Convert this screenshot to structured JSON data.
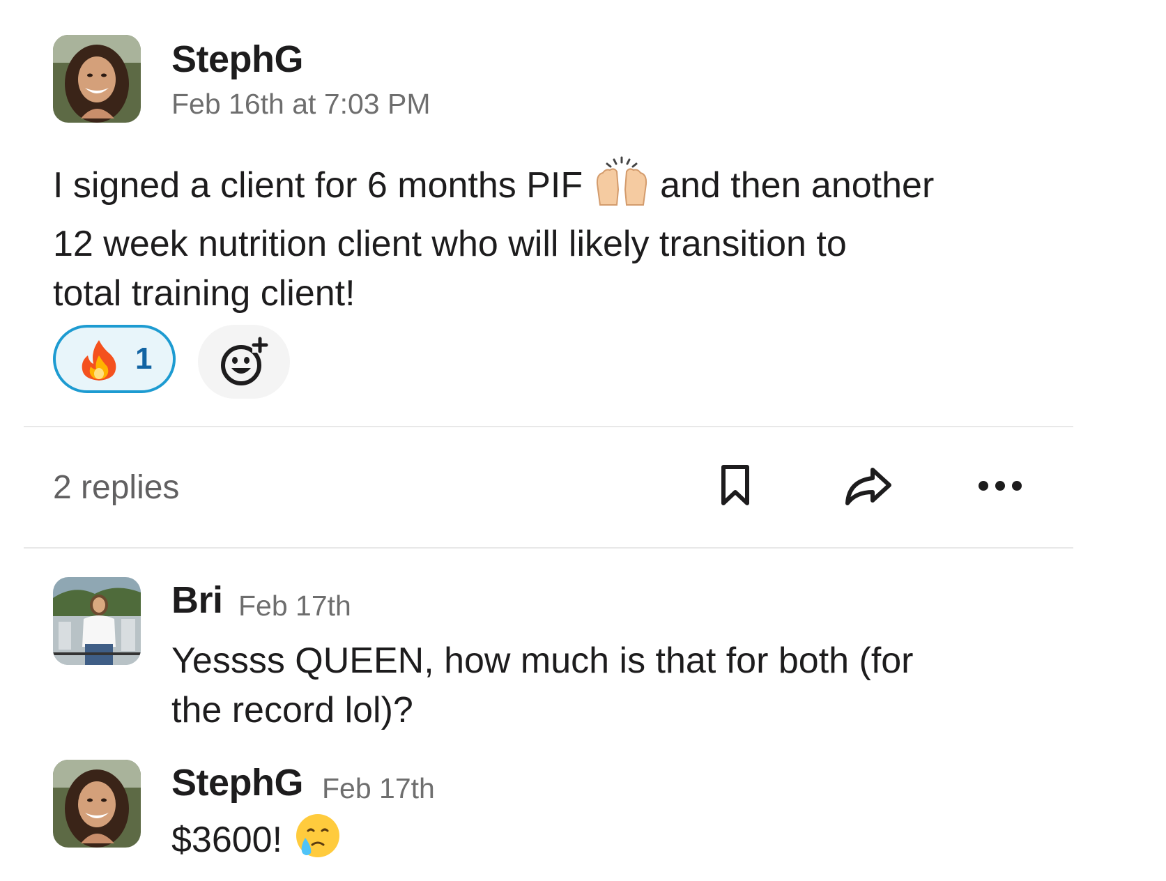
{
  "post": {
    "author": "StephG",
    "timestamp": "Feb 16th at 7:03 PM",
    "message_lines": [
      "I signed a client for 6 months PIF",
      "and then another",
      "12 week nutrition client who will likely transition to",
      "total training client!"
    ],
    "inline_emoji": "raising-hands",
    "reactions": [
      {
        "emoji": "fire",
        "count": "1",
        "selected": true
      }
    ]
  },
  "thread_bar": {
    "replies_label": "2 replies"
  },
  "replies": [
    {
      "author": "Bri",
      "timestamp": "Feb 17th",
      "lines": [
        "Yessss QUEEN, how much is that for both (for",
        "the record lol)?"
      ]
    },
    {
      "author": "StephG",
      "timestamp": "Feb 17th",
      "text": "$3600!",
      "emoji": "crying-face"
    }
  ],
  "colors": {
    "reaction_border": "#1d9bd1",
    "reaction_bg": "#e8f5fa",
    "reaction_count": "#1264a3",
    "timestamp": "#6e6e6e",
    "divider": "#e8e8e8"
  }
}
